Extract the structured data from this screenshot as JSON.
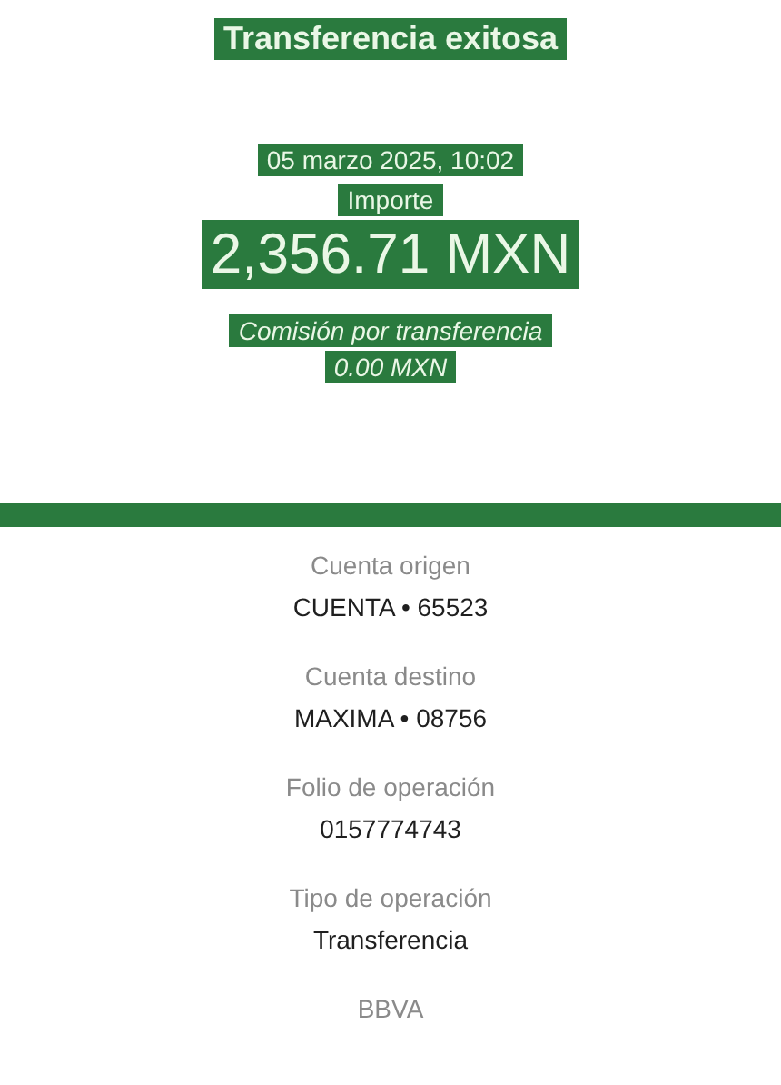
{
  "header": {
    "title": "Transferencia exitosa",
    "datetime": "05 marzo 2025, 10:02",
    "amount_label": "Importe",
    "amount": "2,356.71 MXN",
    "fee_label": "Comisión por transferencia",
    "fee": "0.00 MXN"
  },
  "details": [
    {
      "label": "Cuenta origen",
      "value": "CUENTA • 65523"
    },
    {
      "label": "Cuenta destino",
      "value": "MAXIMA • 08756"
    },
    {
      "label": "Folio de operación",
      "value": "0157774743"
    },
    {
      "label": "Tipo de operación",
      "value": "Transferencia"
    }
  ],
  "footer": "BBVA"
}
